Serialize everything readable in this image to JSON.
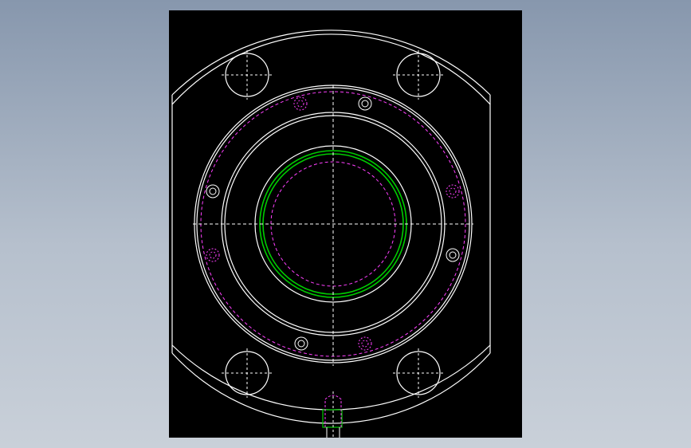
{
  "viewport": {
    "background": "#000000",
    "drawing_colors": {
      "outline": "#ffffff",
      "hidden": "#ff40ff",
      "seal": "#00cc00",
      "center": "#ffffff"
    }
  },
  "app": {
    "background_gradient": [
      "#8797ad",
      "#c9d0d9"
    ]
  }
}
